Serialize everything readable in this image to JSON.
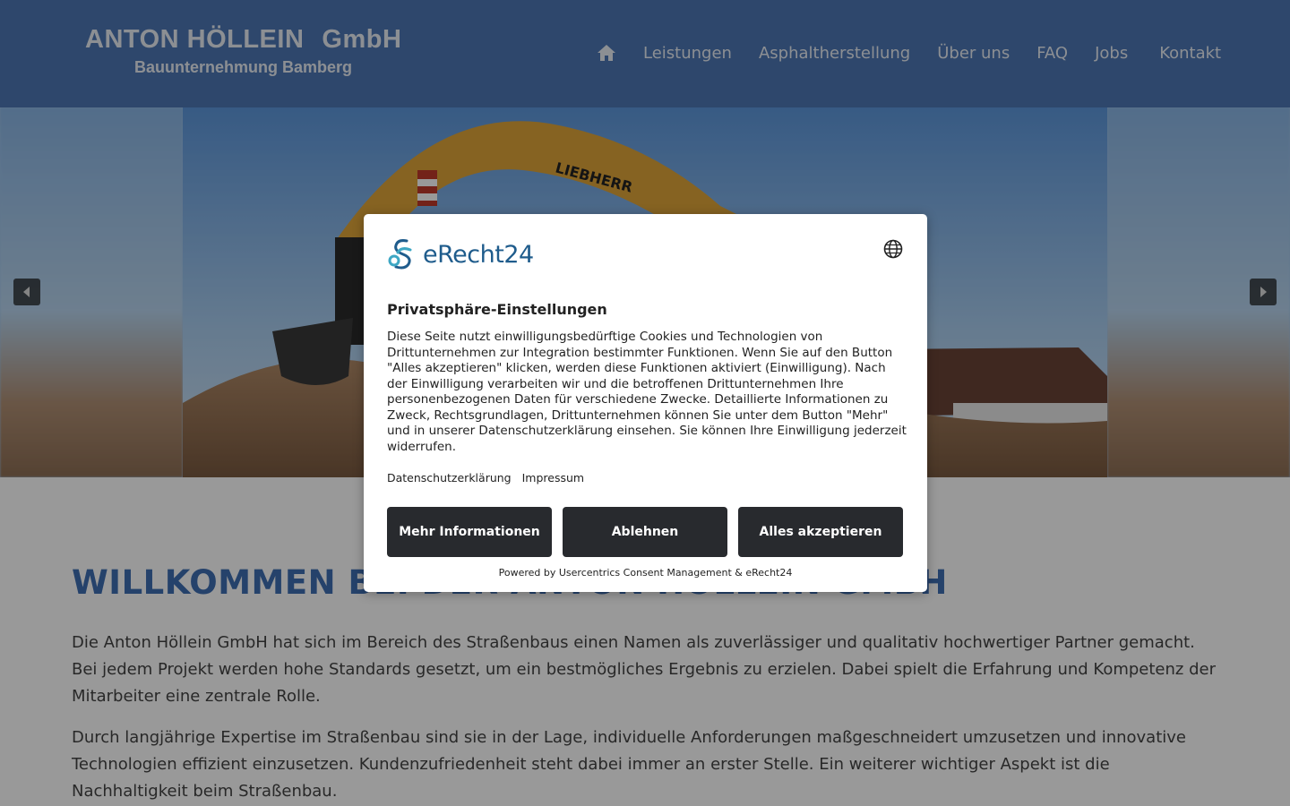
{
  "header": {
    "logo_title_part1": "ANTON  HÖLLEIN",
    "logo_title_part2": "GmbH",
    "logo_subtitle": "Bauunternehmung Bamberg",
    "nav": [
      {
        "label": "Leistungen"
      },
      {
        "label": "Asphaltherstellung"
      },
      {
        "label": "Über uns"
      },
      {
        "label": "FAQ"
      },
      {
        "label": "Jobs"
      },
      {
        "label": "Kontakt"
      }
    ],
    "home_icon": "home-icon",
    "colors": {
      "header_bg": "#4d77b5",
      "nav_text": "#e9eef6"
    }
  },
  "hero": {
    "image_text": "LIEBHERR",
    "prev_icon": "caret-left-icon",
    "next_icon": "caret-right-icon"
  },
  "main": {
    "heading": "WILLKOMMEN BEI DER ANTON HÖLLEIN GMBH",
    "paragraphs": [
      "Die Anton Höllein GmbH hat sich im Bereich des Straßenbaus einen Namen als zuverlässiger und qualitativ hochwertiger Partner gemacht. Bei jedem Projekt werden hohe Standards gesetzt, um ein bestmögliches Ergebnis zu erzielen. Dabei spielt die Erfahrung und Kompetenz der Mitarbeiter eine zentrale Rolle.",
      "Durch langjährige Expertise im Straßenbau sind sie in der Lage, individuelle Anforderungen maßgeschneidert umzusetzen und innovative Technologien effizient einzusetzen. Kundenzufriedenheit steht dabei immer an erster Stelle. Ein weiterer wichtiger Aspekt ist die Nachhaltigkeit beim Straßenbau."
    ],
    "colors": {
      "heading": "#3f6eb2"
    }
  },
  "consent": {
    "brand": "eRecht24",
    "globe_icon": "globe-icon",
    "title": "Privatsphäre-Einstellungen",
    "text": "Diese Seite nutzt einwilligungsbedürftige Cookies und Technologien von Drittunternehmen zur Integration bestimmter Funktionen. Wenn Sie auf den Button \"Alles akzeptieren\" klicken, werden diese Funktionen aktiviert (Einwilligung). Nach der Einwilligung verarbeiten wir und die betroffenen Drittunternehmen Ihre personenbezogenen Daten für verschiedene Zwecke. Detaillierte Informationen zu Zweck, Rechtsgrundlagen, Drittunternehmen können Sie unter dem Button \"Mehr\" und in unserer Datenschutzerklärung einsehen. Sie können Ihre Einwilligung jederzeit widerrufen.",
    "link_privacy": "Datenschutzerklärung",
    "link_imprint": "Impressum",
    "btn_more": "Mehr Informationen",
    "btn_decline": "Ablehnen",
    "btn_accept": "Alles akzeptieren",
    "powered_by": "Powered by Usercentrics Consent Management & eRecht24",
    "colors": {
      "button_bg": "#282a2e",
      "brand": "#1f5c8c"
    }
  }
}
